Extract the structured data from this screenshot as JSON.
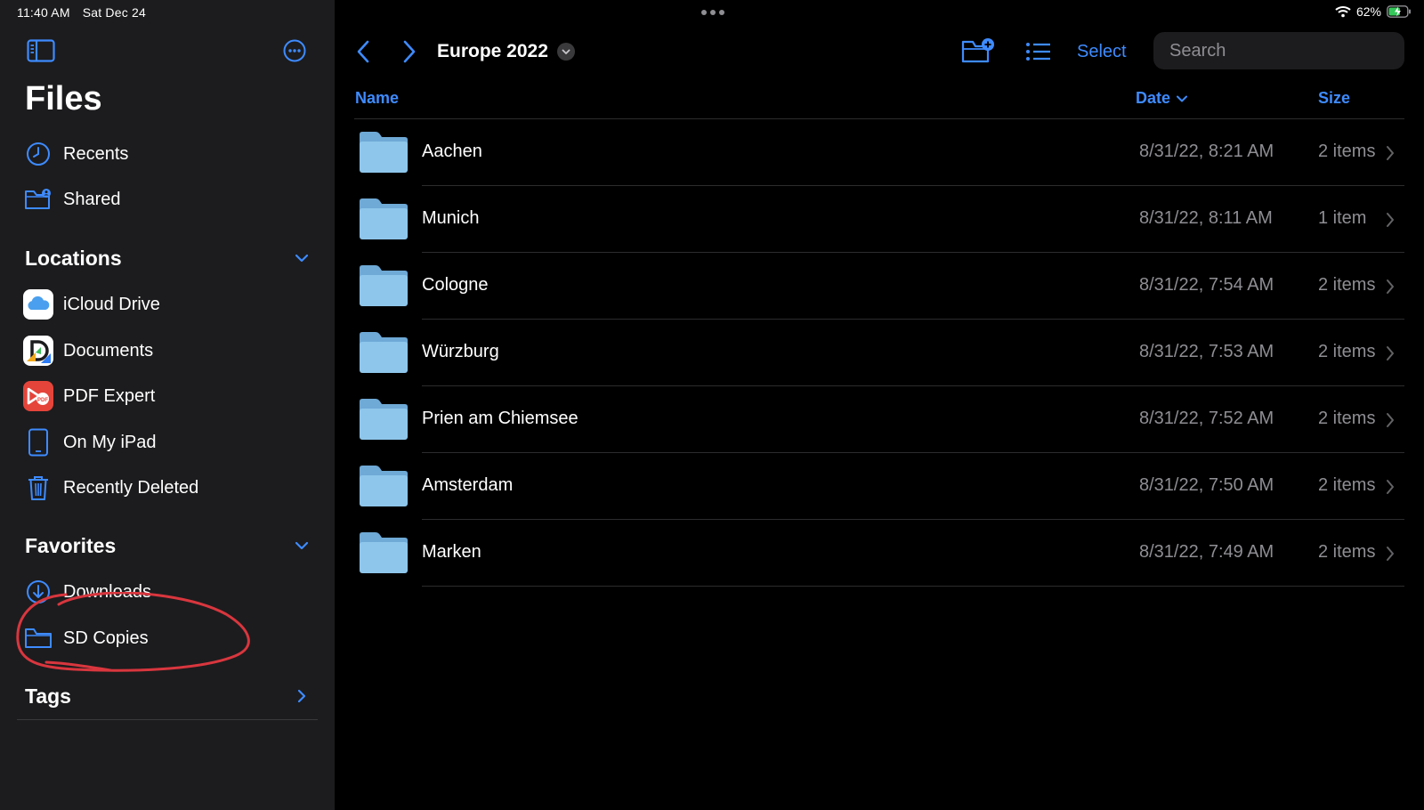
{
  "status": {
    "time": "11:40 AM",
    "date": "Sat Dec 24",
    "battery": "62%"
  },
  "sidebar": {
    "title": "Files",
    "top_items": [
      {
        "label": "Recents",
        "icon": "clock-icon"
      },
      {
        "label": "Shared",
        "icon": "shared-folder-icon"
      }
    ],
    "locations": {
      "header": "Locations",
      "items": [
        {
          "label": "iCloud Drive",
          "icon": "icloud-icon"
        },
        {
          "label": "Documents",
          "icon": "documents-app-icon"
        },
        {
          "label": "PDF Expert",
          "icon": "pdf-expert-icon"
        },
        {
          "label": "On My iPad",
          "icon": "ipad-icon"
        },
        {
          "label": "Recently Deleted",
          "icon": "trash-icon"
        }
      ]
    },
    "favorites": {
      "header": "Favorites",
      "items": [
        {
          "label": "Downloads",
          "icon": "download-icon"
        },
        {
          "label": "SD Copies",
          "icon": "folder-icon"
        }
      ]
    },
    "tags": {
      "header": "Tags"
    }
  },
  "toolbar": {
    "folder_title": "Europe 2022",
    "select_label": "Select",
    "search_placeholder": "Search"
  },
  "columns": {
    "name": "Name",
    "date": "Date",
    "size": "Size"
  },
  "files": [
    {
      "name": "Aachen",
      "date": "8/31/22, 8:21 AM",
      "size": "2 items"
    },
    {
      "name": "Munich",
      "date": "8/31/22, 8:11 AM",
      "size": "1 item"
    },
    {
      "name": "Cologne",
      "date": "8/31/22, 7:54 AM",
      "size": "2 items"
    },
    {
      "name": "Würzburg",
      "date": "8/31/22, 7:53 AM",
      "size": "2 items"
    },
    {
      "name": "Prien am Chiemsee",
      "date": "8/31/22, 7:52 AM",
      "size": "2 items"
    },
    {
      "name": "Amsterdam",
      "date": "8/31/22, 7:50 AM",
      "size": "2 items"
    },
    {
      "name": "Marken",
      "date": "8/31/22, 7:49 AM",
      "size": "2 items"
    }
  ],
  "colors": {
    "accent": "#3e8bff",
    "sidebar_bg": "#1c1c1e",
    "annotation": "#d9363e"
  }
}
